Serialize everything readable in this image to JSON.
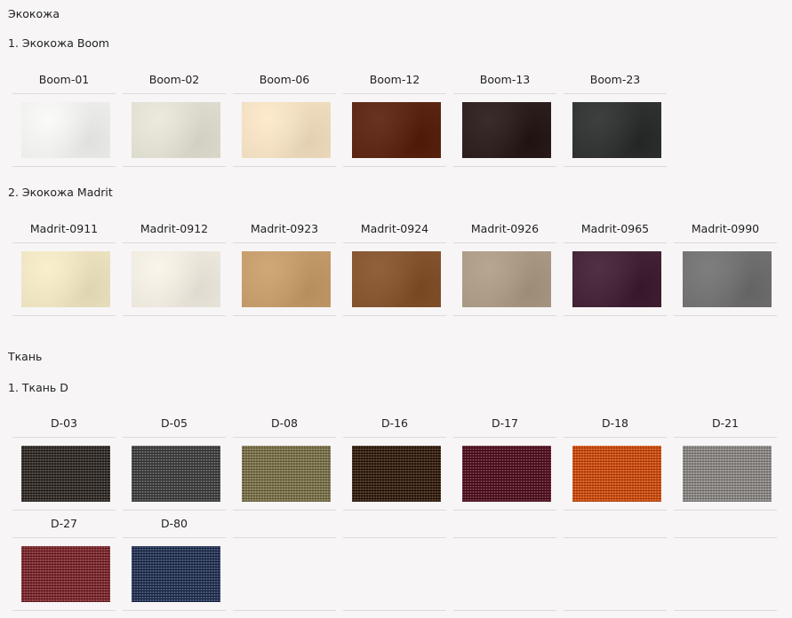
{
  "sections": [
    {
      "title": "Экокожа",
      "groups": [
        {
          "title": "1. Экокожа Boom",
          "items": [
            {
              "label": "Boom-01",
              "color": "#ecedea",
              "kind": "leather"
            },
            {
              "label": "Boom-02",
              "color": "#dedbcf",
              "kind": "leather"
            },
            {
              "label": "Boom-06",
              "color": "#efdcbe",
              "kind": "leather"
            },
            {
              "label": "Boom-12",
              "color": "#5b2513",
              "kind": "leather"
            },
            {
              "label": "Boom-13",
              "color": "#2c1e1c",
              "kind": "leather"
            },
            {
              "label": "Boom-23",
              "color": "#303131",
              "kind": "leather"
            }
          ]
        },
        {
          "title": "2. Экокожа Madrit",
          "items": [
            {
              "label": "Madrit-0911",
              "color": "#ebe1bf",
              "kind": "leather"
            },
            {
              "label": "Madrit-0912",
              "color": "#ebe7dc",
              "kind": "leather"
            },
            {
              "label": "Madrit-0923",
              "color": "#c29a69",
              "kind": "leather"
            },
            {
              "label": "Madrit-0924",
              "color": "#83532e",
              "kind": "leather"
            },
            {
              "label": "Madrit-0926",
              "color": "#a99883",
              "kind": "leather"
            },
            {
              "label": "Madrit-0965",
              "color": "#422235",
              "kind": "leather"
            },
            {
              "label": "Madrit-0990",
              "color": "#707070",
              "kind": "leather"
            }
          ]
        }
      ]
    },
    {
      "title": "Ткань",
      "groups": [
        {
          "title": "1. Ткань D",
          "items": [
            {
              "label": "D-03",
              "color": "#3b3632",
              "kind": "fabric"
            },
            {
              "label": "D-05",
              "color": "#4a4a4a",
              "kind": "fabric"
            },
            {
              "label": "D-08",
              "color": "#7c7350",
              "kind": "fabric"
            },
            {
              "label": "D-16",
              "color": "#3d2a1c",
              "kind": "fabric"
            },
            {
              "label": "D-17",
              "color": "#5a1f2d",
              "kind": "fabric"
            },
            {
              "label": "D-18",
              "color": "#c6521a",
              "kind": "fabric"
            },
            {
              "label": "D-21",
              "color": "#8a8785",
              "kind": "fabric"
            },
            {
              "label": "D-27",
              "color": "#7c3236",
              "kind": "fabric"
            },
            {
              "label": "D-80",
              "color": "#303e5c",
              "kind": "fabric"
            }
          ]
        }
      ]
    }
  ]
}
